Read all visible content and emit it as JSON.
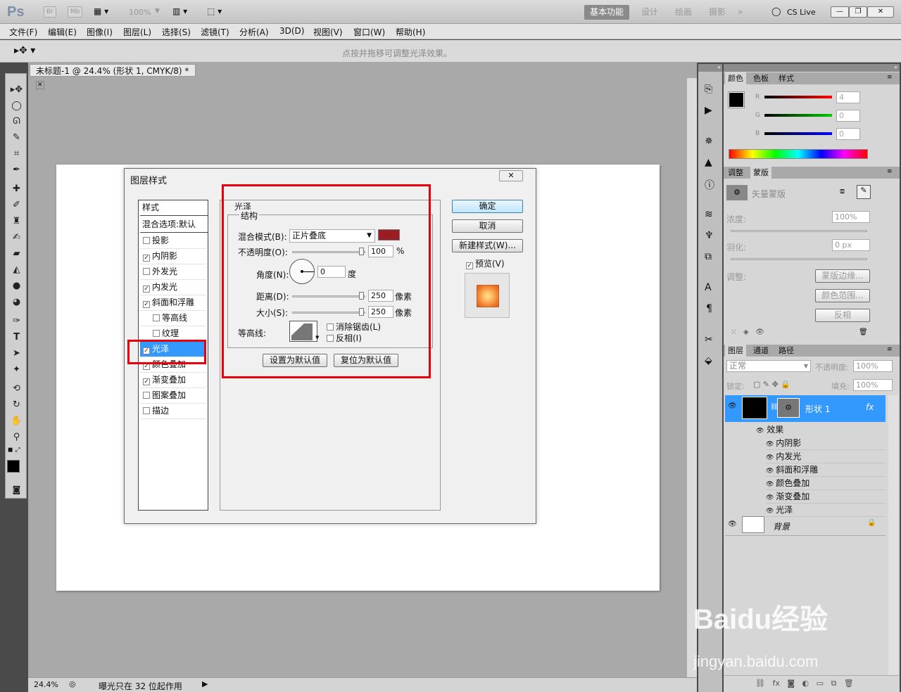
{
  "app": {
    "logo": "Ps",
    "br": "Br",
    "mb": "Mb",
    "zoom_select": "100%",
    "cslive": "CS Live"
  },
  "workspaces": [
    "基本功能",
    "设计",
    "绘画",
    "摄影",
    "»"
  ],
  "menu": [
    "文件(F)",
    "编辑(E)",
    "图像(I)",
    "图层(L)",
    "选择(S)",
    "滤镜(T)",
    "分析(A)",
    "3D(D)",
    "视图(V)",
    "窗口(W)",
    "帮助(H)"
  ],
  "options_hint": "点按并拖移可调整光泽效果。",
  "document": {
    "tab_title": "未标题-1 @ 24.4% (形状 1, CMYK/8) *",
    "zoom": "24.4%",
    "status": "曝光只在 32 位起作用"
  },
  "dialog": {
    "title": "图层样式",
    "list_header": "样式",
    "blend_default": "混合选项:默认",
    "items": [
      {
        "label": "投影",
        "checked": false,
        "indent": false
      },
      {
        "label": "内阴影",
        "checked": true,
        "indent": false
      },
      {
        "label": "外发光",
        "checked": false,
        "indent": false
      },
      {
        "label": "内发光",
        "checked": true,
        "indent": false
      },
      {
        "label": "斜面和浮雕",
        "checked": true,
        "indent": false
      },
      {
        "label": "等高线",
        "checked": false,
        "indent": true
      },
      {
        "label": "纹理",
        "checked": false,
        "indent": true
      },
      {
        "label": "光泽",
        "checked": true,
        "indent": false,
        "selected": true
      },
      {
        "label": "颜色叠加",
        "checked": true,
        "indent": false
      },
      {
        "label": "渐变叠加",
        "checked": true,
        "indent": false
      },
      {
        "label": "图案叠加",
        "checked": false,
        "indent": false
      },
      {
        "label": "描边",
        "checked": false,
        "indent": false
      }
    ],
    "section_title": "光泽",
    "structure_title": "结构",
    "blend_mode_label": "混合模式(B):",
    "blend_mode_value": "正片叠底",
    "blend_color": "#9b1c22",
    "opacity_label": "不透明度(O):",
    "opacity_value": "100",
    "opacity_unit": "%",
    "angle_label": "角度(N):",
    "angle_value": "0",
    "angle_unit": "度",
    "distance_label": "距离(D):",
    "distance_value": "250",
    "size_label": "大小(S):",
    "size_value": "250",
    "px_unit": "像素",
    "contour_label": "等高线:",
    "antialias_label": "消除锯齿(L)",
    "invert_label": "反相(I)",
    "set_default": "设置为默认值",
    "reset_default": "复位为默认值",
    "ok": "确定",
    "cancel": "取消",
    "new_style": "新建样式(W)...",
    "preview_label": "预览(V)"
  },
  "color_panel": {
    "tabs": [
      "颜色",
      "色板",
      "样式"
    ],
    "r_label": "R",
    "g_label": "G",
    "b_label": "B",
    "r_value": "4",
    "g_value": "0",
    "b_value": "0"
  },
  "masks_panel": {
    "tabs": [
      "调整",
      "蒙版"
    ],
    "title": "矢量蒙版",
    "density_label": "浓度:",
    "density_value": "100%",
    "feather_label": "羽化:",
    "feather_value": "0 px",
    "refine_label": "调整:",
    "mask_edge": "蒙版边缘...",
    "color_range": "颜色范围...",
    "invert": "反相"
  },
  "layers_panel": {
    "tabs": [
      "图层",
      "通道",
      "路径"
    ],
    "blend": "正常",
    "opacity_label": "不透明度:",
    "opacity_value": "100%",
    "lock_label": "锁定:",
    "fill_label": "填充:",
    "fill_value": "100%",
    "layer1": "形状 1",
    "fx": "fx",
    "effects_label": "效果",
    "effects": [
      "内阴影",
      "内发光",
      "斜面和浮雕",
      "颜色叠加",
      "渐变叠加",
      "光泽"
    ],
    "background": "背景"
  },
  "watermark": {
    "line1": "Baidu经验",
    "line2": "jingyan.baidu.com"
  }
}
